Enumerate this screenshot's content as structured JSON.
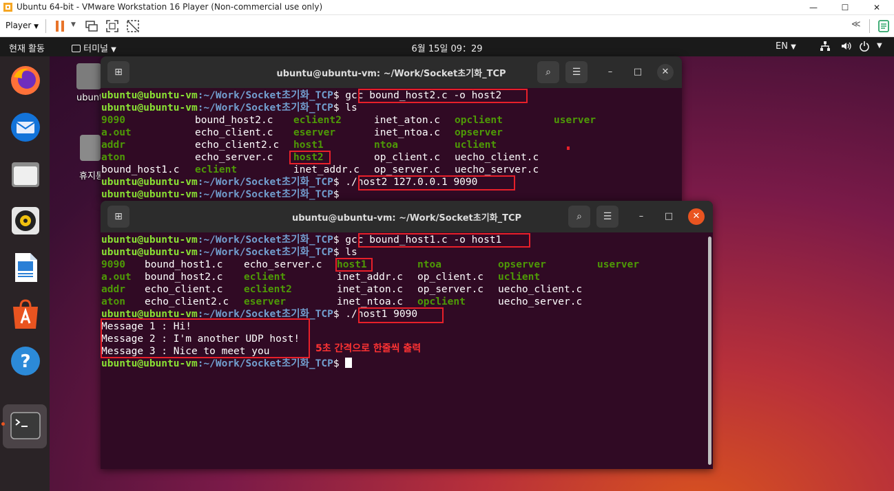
{
  "vmware": {
    "title": "Ubuntu 64-bit - VMware Workstation 16 Player (Non-commercial use only)",
    "player_menu": "Player",
    "minimize": "—",
    "maximize": "☐",
    "close": "✕"
  },
  "topbar": {
    "activities": "현재 활동",
    "app_menu": "터미널",
    "clock": "6월 15일  09：29",
    "language": "EN"
  },
  "desktop_icons": {
    "home_label": "ubuntu",
    "trash_label": "휴지통"
  },
  "back_terminal": {
    "title": "ubuntu@ubuntu-vm: ~/Work/Socket초기화_TCP",
    "prompt_user": "ubuntu@ubuntu-vm",
    "prompt_path": ":~/Work/Socket초기화_TCP",
    "cmd1": "$ gcc bound_host2.c -o host2",
    "cmd2": "$ ls",
    "cmd3": "$ ./host2 127.0.0.1 9090",
    "cmd4": "$",
    "ls_rows": [
      [
        {
          "t": "9090",
          "c": "g"
        },
        {
          "t": "bound_host2.c",
          "c": "w"
        },
        {
          "t": "eclient2",
          "c": "g"
        },
        {
          "t": "inet_aton.c",
          "c": "w"
        },
        {
          "t": "opclient",
          "c": "g"
        },
        {
          "t": "userver",
          "c": "g"
        }
      ],
      [
        {
          "t": "a.out",
          "c": "g"
        },
        {
          "t": "echo_client.c",
          "c": "w"
        },
        {
          "t": "eserver",
          "c": "g"
        },
        {
          "t": "inet_ntoa.c",
          "c": "w"
        },
        {
          "t": "opserver",
          "c": "g"
        },
        {
          "t": "",
          "c": "w"
        }
      ],
      [
        {
          "t": "addr",
          "c": "g"
        },
        {
          "t": "echo_client2.c",
          "c": "w"
        },
        {
          "t": "host1",
          "c": "g"
        },
        {
          "t": "ntoa",
          "c": "g"
        },
        {
          "t": "uclient",
          "c": "g"
        },
        {
          "t": "",
          "c": "w"
        }
      ],
      [
        {
          "t": "aton",
          "c": "g"
        },
        {
          "t": "echo_server.c",
          "c": "w"
        },
        {
          "t": "host2",
          "c": "g"
        },
        {
          "t": "op_client.c",
          "c": "w"
        },
        {
          "t": "uecho_client.c",
          "c": "w"
        },
        {
          "t": "",
          "c": "w"
        }
      ],
      [
        {
          "t": "bound_host1.c",
          "c": "w"
        },
        {
          "t": "eclient",
          "c": "g"
        },
        {
          "t": "inet_addr.c",
          "c": "w"
        },
        {
          "t": "op_server.c",
          "c": "w"
        },
        {
          "t": "uecho_server.c",
          "c": "w"
        },
        {
          "t": "",
          "c": "w"
        }
      ]
    ]
  },
  "front_terminal": {
    "title": "ubuntu@ubuntu-vm: ~/Work/Socket초기화_TCP",
    "prompt_user": "ubuntu@ubuntu-vm",
    "prompt_path": ":~/Work/Socket초기화_TCP",
    "cmd1": "$ gcc bound_host1.c -o host1",
    "cmd2": "$ ls",
    "cmd3": "$ ./host1 9090",
    "cmd4": "$ ",
    "ls_rows": [
      [
        {
          "t": "9090",
          "c": "g"
        },
        {
          "t": "bound_host1.c",
          "c": "w"
        },
        {
          "t": "echo_server.c",
          "c": "w"
        },
        {
          "t": "host1",
          "c": "g"
        },
        {
          "t": "ntoa",
          "c": "g"
        },
        {
          "t": "opserver",
          "c": "g"
        },
        {
          "t": "userver",
          "c": "g"
        }
      ],
      [
        {
          "t": "a.out",
          "c": "g"
        },
        {
          "t": "bound_host2.c",
          "c": "w"
        },
        {
          "t": "eclient",
          "c": "g"
        },
        {
          "t": "inet_addr.c",
          "c": "w"
        },
        {
          "t": "op_client.c",
          "c": "w"
        },
        {
          "t": "uclient",
          "c": "g"
        },
        {
          "t": "",
          "c": "w"
        }
      ],
      [
        {
          "t": "addr",
          "c": "g"
        },
        {
          "t": "echo_client.c",
          "c": "w"
        },
        {
          "t": "eclient2",
          "c": "g"
        },
        {
          "t": "inet_aton.c",
          "c": "w"
        },
        {
          "t": "op_server.c",
          "c": "w"
        },
        {
          "t": "uecho_client.c",
          "c": "w"
        },
        {
          "t": "",
          "c": "w"
        }
      ],
      [
        {
          "t": "aton",
          "c": "g"
        },
        {
          "t": "echo_client2.c",
          "c": "w"
        },
        {
          "t": "eserver",
          "c": "g"
        },
        {
          "t": "inet_ntoa.c",
          "c": "w"
        },
        {
          "t": "opclient",
          "c": "g"
        },
        {
          "t": "uecho_server.c",
          "c": "w"
        },
        {
          "t": "",
          "c": "w"
        }
      ]
    ],
    "messages": [
      "Message 1 : Hi!",
      "Message 2 : I'm another UDP host!",
      "Message 3 : Nice to meet you"
    ],
    "annotation": "5초 간격으로 한줄씩 출력"
  },
  "colors": {
    "terminal_bg": "#300a24",
    "prompt_user": "#8ae234",
    "prompt_path": "#729fcf",
    "executable": "#4e9a06",
    "highlight_box": "#e8202a",
    "close_button": "#e95420"
  }
}
